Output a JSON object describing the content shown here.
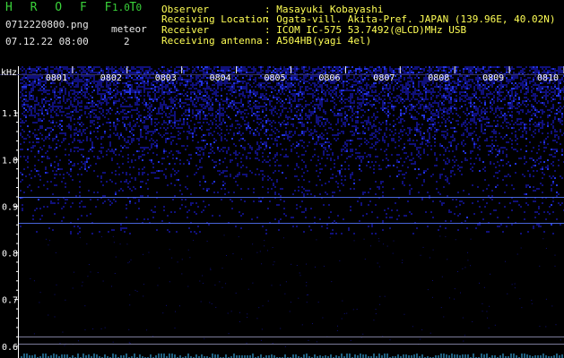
{
  "header": {
    "app_title": "H R O F F T",
    "version": "1.0.0",
    "filename": "0712220800.png",
    "meteor_label": "meteor",
    "datetime": "07.12.22 08:00",
    "meteor_count": "2"
  },
  "station_info": [
    {
      "label": "Observer",
      "value": ": Masayuki Kobayashi"
    },
    {
      "label": "Receiving Location",
      "value": ": Ogata-vill. Akita-Pref. JAPAN (139.96E, 40.02N)"
    },
    {
      "label": "Receiver",
      "value": ": ICOM IC-575 53.7492(@LCD)MHz USB"
    },
    {
      "label": "Receiving antenna",
      "value": ": A504HB(yagi 4el)"
    }
  ],
  "chart_data": {
    "type": "heatmap",
    "y_unit": "kHz",
    "y_ticks": [
      "1.1",
      "1.0",
      "0.9",
      "0.8",
      "0.7",
      "0.6"
    ],
    "x_ticks": [
      "0801",
      "0802",
      "0803",
      "0804",
      "0805",
      "0806",
      "0807",
      "0808",
      "0809",
      "0810"
    ],
    "ylim": [
      0.59,
      1.2
    ],
    "noise_band_top_khz": 1.2,
    "noise_band_bottom_khz": 0.84,
    "carrier_lines_khz": [
      0.92,
      0.865,
      0.62,
      0.605
    ],
    "colors": {
      "background": "#000010",
      "noise_dense": "#2233dd",
      "noise_sparse": "#10107a",
      "carrier": "#5577ff",
      "reference": "#8888aa",
      "axis": "#ffffff",
      "tick_label": "#ffffff",
      "bottom_trace": "#40c0ff"
    }
  }
}
